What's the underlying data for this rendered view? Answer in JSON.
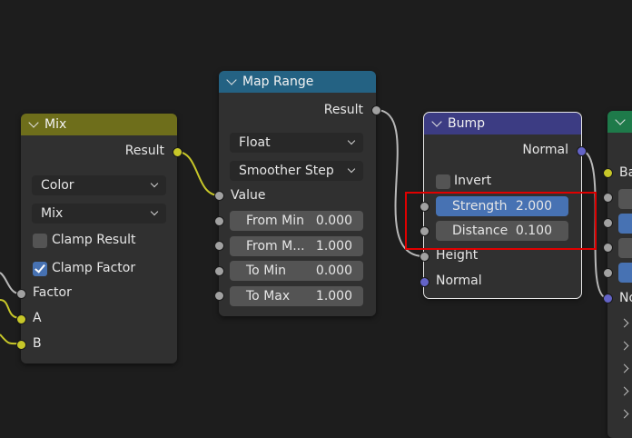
{
  "colors": {
    "background": "#1d1d1d",
    "mix_header": "#6e6e1b",
    "map_range_header": "#246283",
    "bump_header": "#3c3c83",
    "right_node_header": "#1e7a4a",
    "highlight": "#e00000",
    "socket_float": "#a1a1a1",
    "socket_color": "#c7c729",
    "socket_vector": "#6363c7"
  },
  "mix_node": {
    "title": "Mix",
    "output": "Result",
    "data_type": "Color",
    "blend_mode": "Mix",
    "clamp_result_label": "Clamp Result",
    "clamp_result_checked": false,
    "clamp_factor_label": "Clamp Factor",
    "clamp_factor_checked": true,
    "inputs": [
      "Factor",
      "A",
      "B"
    ]
  },
  "map_range_node": {
    "title": "Map Range",
    "output": "Result",
    "data_type": "Float",
    "interpolation": "Smoother Step",
    "value_label": "Value",
    "fields": [
      {
        "label": "From Min",
        "value": "0.000"
      },
      {
        "label": "From M...",
        "value": "1.000"
      },
      {
        "label": "To Min",
        "value": "0.000"
      },
      {
        "label": "To Max",
        "value": "1.000"
      }
    ]
  },
  "bump_node": {
    "title": "Bump",
    "output": "Normal",
    "invert_label": "Invert",
    "invert_checked": false,
    "strength": {
      "label": "Strength",
      "value": "2.000"
    },
    "distance": {
      "label": "Distance",
      "value": "0.100"
    },
    "inputs": [
      "Height",
      "Normal"
    ]
  },
  "right_node": {
    "labels": [
      "Ba",
      "No"
    ]
  }
}
